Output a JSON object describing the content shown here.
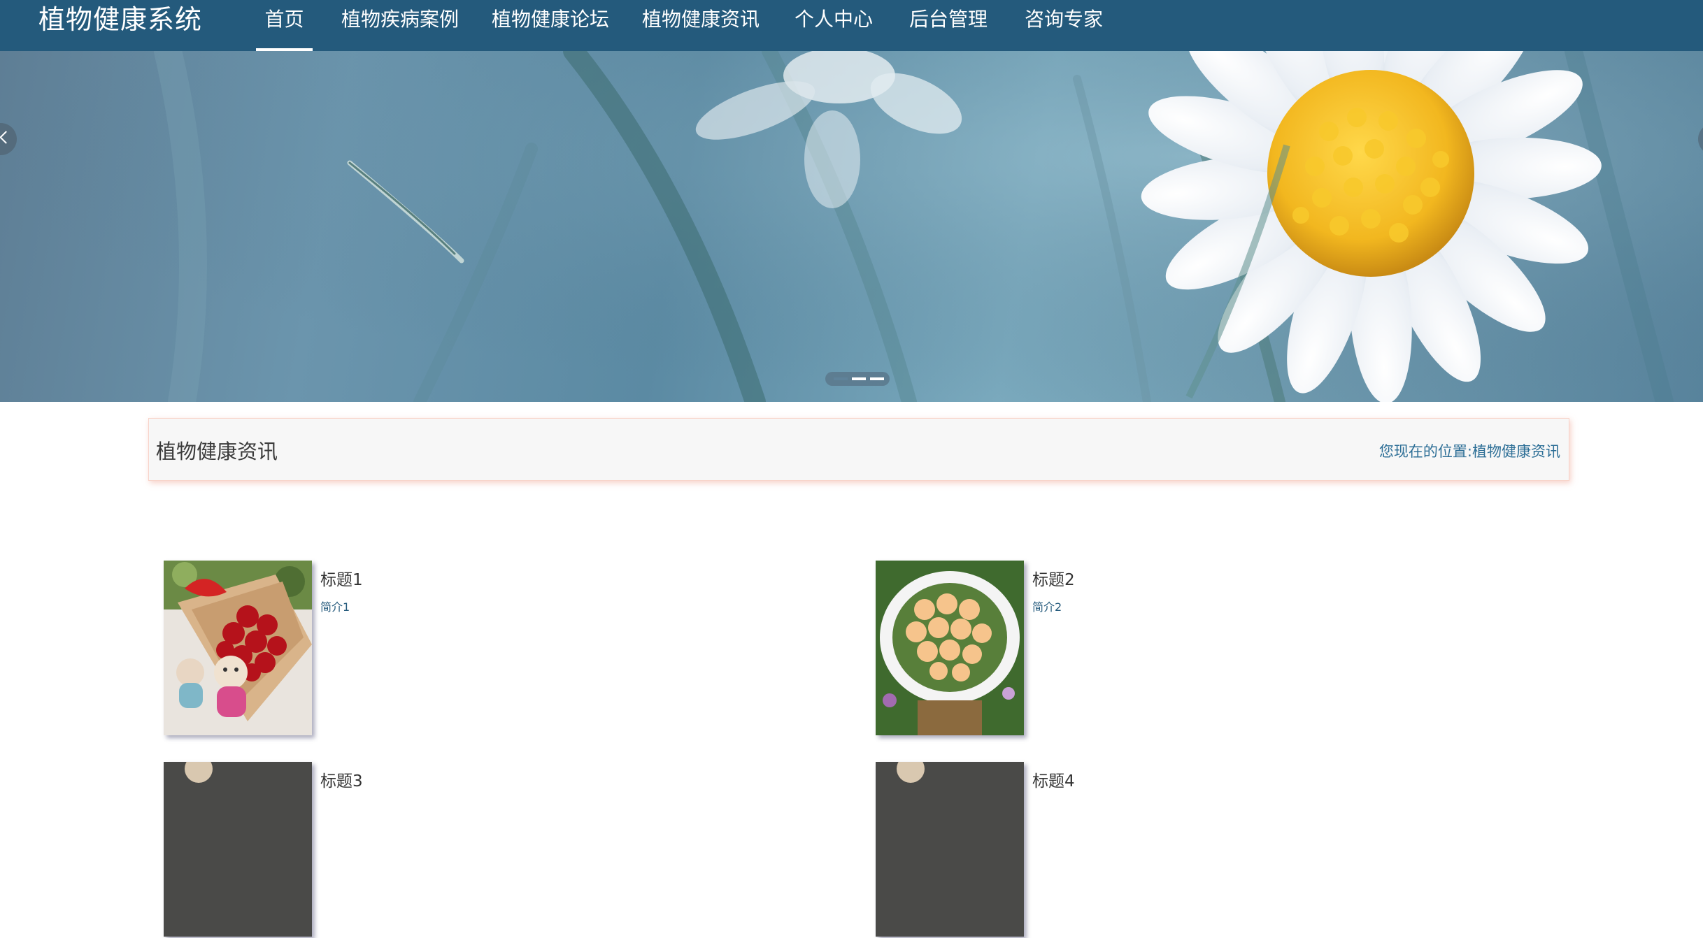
{
  "header": {
    "brand": "植物健康系统",
    "nav": [
      {
        "label": "首页",
        "active": true
      },
      {
        "label": "植物疾病案例",
        "active": false
      },
      {
        "label": "植物健康论坛",
        "active": false
      },
      {
        "label": "植物健康资讯",
        "active": false
      },
      {
        "label": "个人中心",
        "active": false
      },
      {
        "label": "后台管理",
        "active": false
      },
      {
        "label": "咨询专家",
        "active": false
      }
    ]
  },
  "banner": {
    "slide_count": 3,
    "current_slide": 1,
    "prev_icon": "chevron-left-icon",
    "next_icon": "chevron-right-icon"
  },
  "section": {
    "title": "植物健康资讯",
    "breadcrumb_prefix": "您现在的位置:",
    "breadcrumb_current": "植物健康资讯"
  },
  "news": [
    {
      "title": "标题1",
      "intro": "简介1",
      "image": "red-rose-bouquet-with-teddy-bears"
    },
    {
      "title": "标题2",
      "intro": "简介2",
      "image": "peach-rose-bouquet-in-basket"
    },
    {
      "title": "标题3",
      "intro": "",
      "image": "bouquet-photo"
    },
    {
      "title": "标题4",
      "intro": "",
      "image": "bouquet-photo"
    }
  ],
  "colors": {
    "nav_background": "#245a7c",
    "accent_link": "#2c6e96",
    "panel_background": "#f7f7f7",
    "panel_border": "#f8d3c9"
  }
}
